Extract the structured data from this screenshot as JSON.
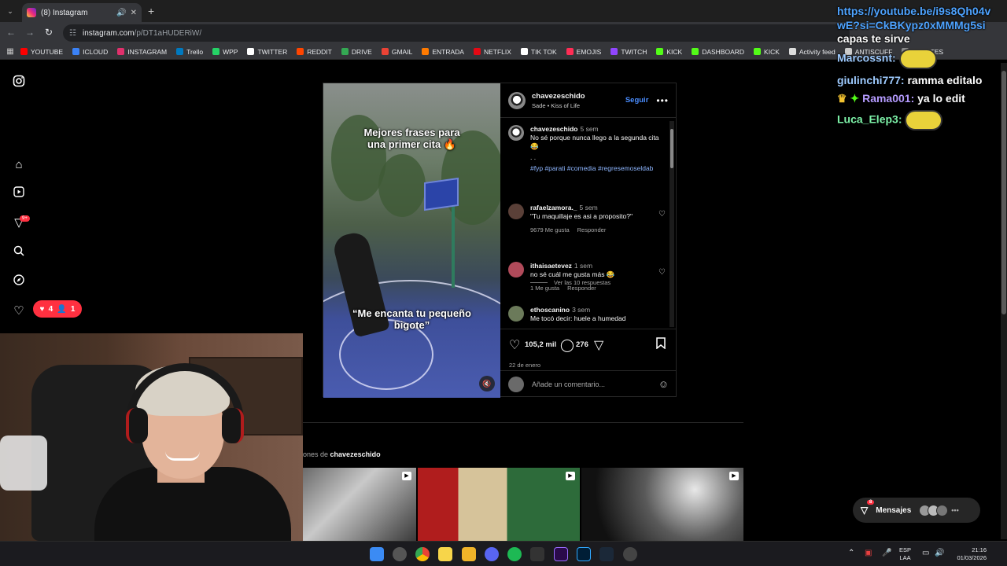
{
  "browser": {
    "tab_title": "(8) Instagram",
    "url_host": "instagram.com",
    "url_path": "/p/DT1aHUDERiW/",
    "bookmarks": [
      {
        "label": "YOUTUBE",
        "color": "#ff0000"
      },
      {
        "label": "ICLOUD",
        "color": "#3b82f6"
      },
      {
        "label": "INSTAGRAM",
        "color": "#e1306c"
      },
      {
        "label": "Trello",
        "color": "#0079bf"
      },
      {
        "label": "WPP",
        "color": "#25d366"
      },
      {
        "label": "TWITTER",
        "color": "#ffffff"
      },
      {
        "label": "REDDIT",
        "color": "#ff4500"
      },
      {
        "label": "DRIVE",
        "color": "#34a853"
      },
      {
        "label": "GMAIL",
        "color": "#ea4335"
      },
      {
        "label": "ENTRADA",
        "color": "#ff7a00"
      },
      {
        "label": "NETFLIX",
        "color": "#e50914"
      },
      {
        "label": "TIK TOK",
        "color": "#ffffff"
      },
      {
        "label": "EMOJIS",
        "color": "#ff2d55"
      },
      {
        "label": "TWITCH",
        "color": "#9146ff"
      },
      {
        "label": "KICK",
        "color": "#53fc18"
      },
      {
        "label": "DASHBOARD",
        "color": "#53fc18"
      },
      {
        "label": "KICK",
        "color": "#53fc18"
      },
      {
        "label": "Activity feed",
        "color": "#dddddd"
      },
      {
        "label": "ANTISCUFF",
        "color": "#cccccc"
      },
      {
        "label": "FUENTES",
        "color": "#888888"
      }
    ]
  },
  "instagram": {
    "nav_badge": "9+",
    "notifications": {
      "likes": "4",
      "follows": "1"
    },
    "post": {
      "username": "chavezeschido",
      "audio": "Sade • Kiss of Life",
      "follow_label": "Seguir",
      "video_caption_top": "Mejores frases para una primer cita 🔥",
      "video_caption_bottom": "“Me encanta tu pequeño bigote”",
      "caption": {
        "user": "chavezeschido",
        "time": "5 sem",
        "text": "No sé porque nunca llego a la segunda cita 😂",
        "dots": ". .",
        "hashtags": "#fyp #parati #comedia #regresemoseldab"
      },
      "comments": [
        {
          "user": "rafaelzamora._",
          "time": "5 sem",
          "text": "\"Tu maquillaje es asi a proposito?\"",
          "likes": "9679 Me gusta",
          "reply": "Responder"
        },
        {
          "user": "ithaisaetevez",
          "time": "1 sem",
          "text": "no sé cuál me gusta más 😂",
          "likes": "1 Me gusta",
          "reply": "Responder"
        },
        {
          "user": "ethoscanino",
          "time": "3 sem",
          "text": "Me tocó decir: huele a humedad"
        }
      ],
      "view_replies": "Ver las 10 respuestas",
      "like_count": "105,2 mil",
      "comment_count": "276",
      "date": "22 de enero",
      "add_comment_placeholder": "Añade un comentario..."
    },
    "more_from_prefix": "ones de",
    "more_from_user": "chavezeschido",
    "messages_label": "Mensajes",
    "messages_badge": "8"
  },
  "chat": {
    "link1": "https://youtube.be/i9s8Qh04v",
    "link2": "wE?si=CkBKypz0xMMMg5si",
    "line1": "capas te sirve",
    "line2_user": "Marcossnt:",
    "line3_user": "giulinchi777:",
    "line3_text": "ramma editalo",
    "line4_user": "Rama001:",
    "line4_text": "ya lo edit",
    "line5_user": "Luca_Elep3:"
  },
  "taskbar": {
    "lang_top": "ESP",
    "lang_bottom": "LAA",
    "time": "21:16",
    "date": "01/03/2026"
  }
}
